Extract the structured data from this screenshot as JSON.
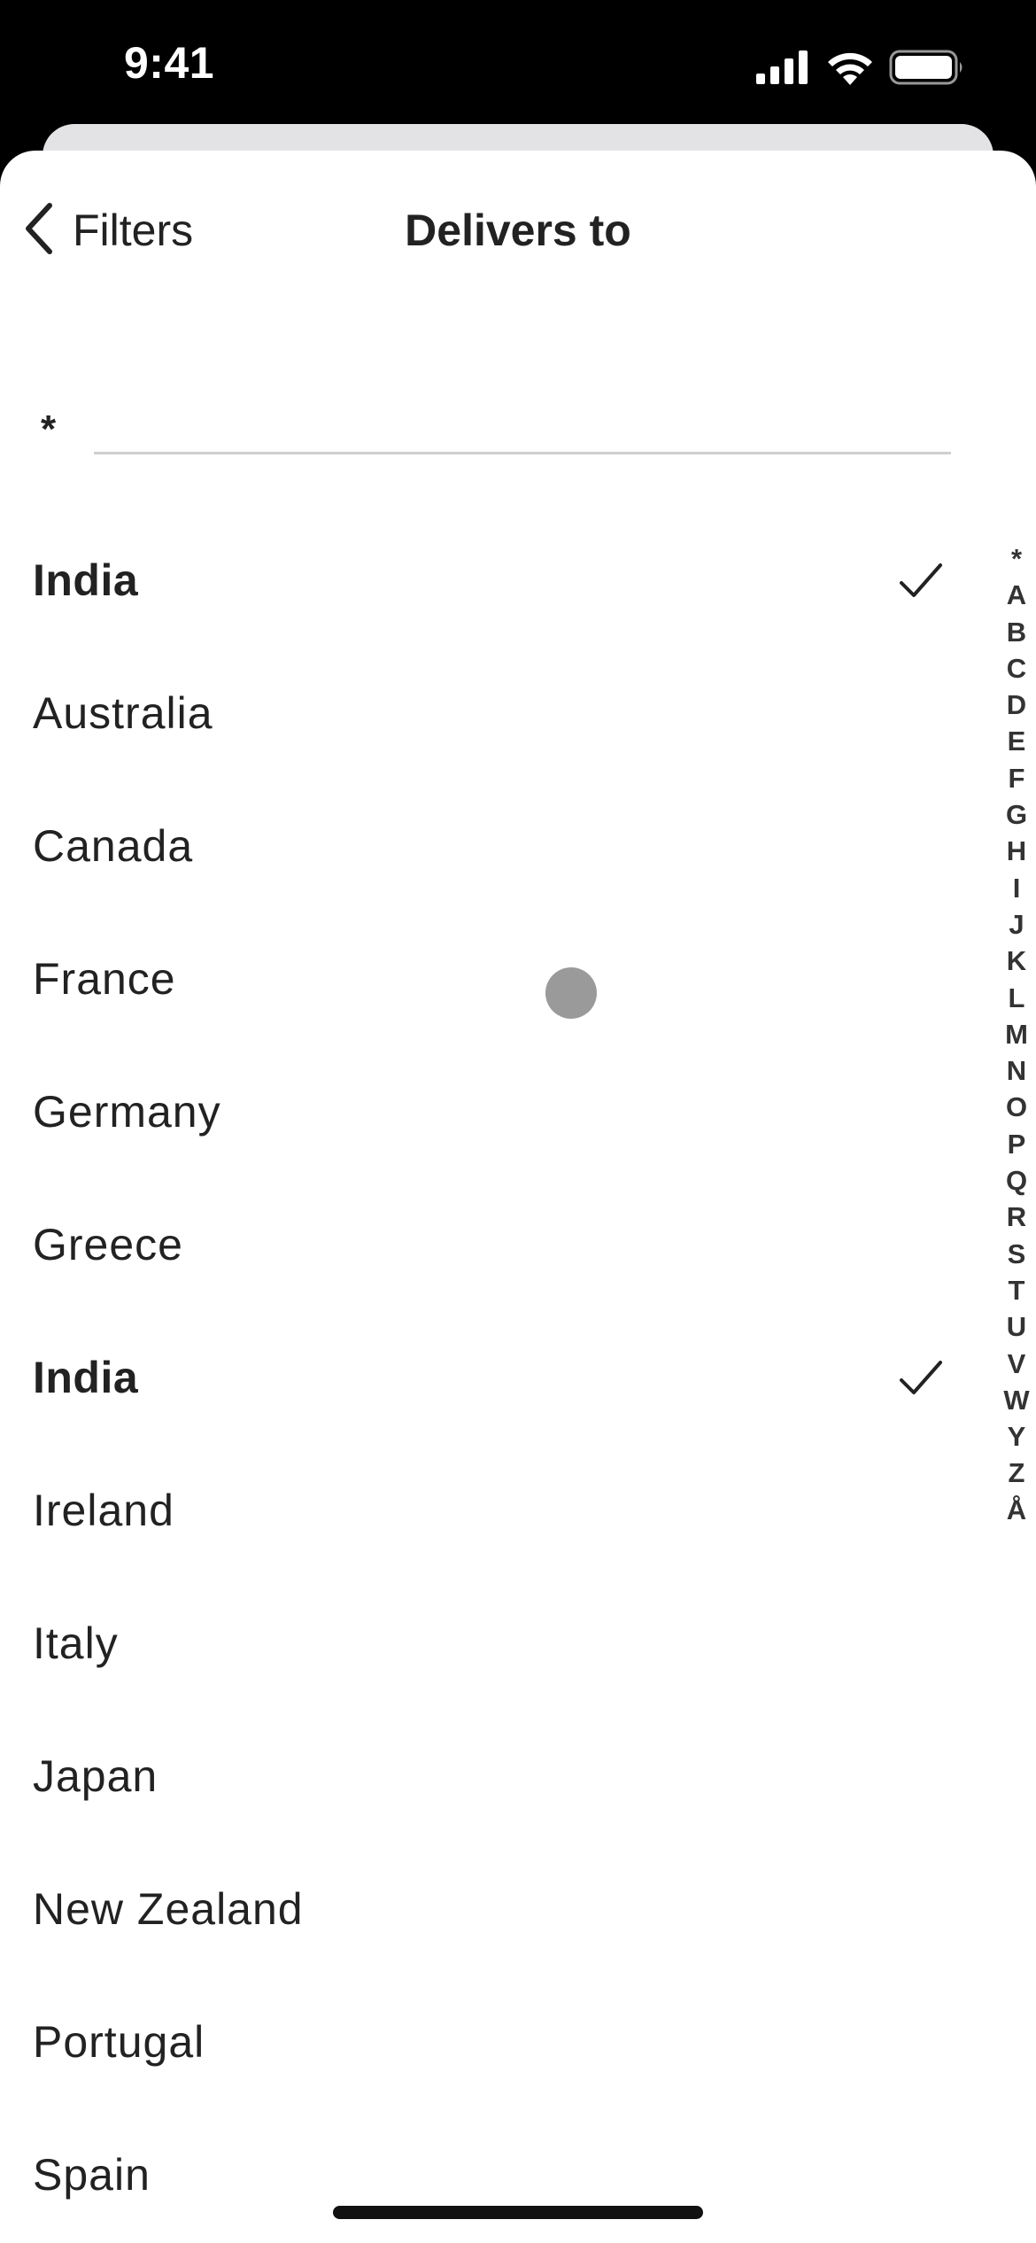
{
  "status_bar": {
    "time": "9:41",
    "icons": [
      "cellular-signal-icon",
      "wifi-icon",
      "battery-icon"
    ]
  },
  "header": {
    "back_label": "Filters",
    "title": "Delivers to"
  },
  "search": {
    "prefix": "*",
    "value": "",
    "placeholder": ""
  },
  "countries": [
    {
      "name": "India",
      "selected": true
    },
    {
      "name": "Australia",
      "selected": false
    },
    {
      "name": "Canada",
      "selected": false
    },
    {
      "name": "France",
      "selected": false
    },
    {
      "name": "Germany",
      "selected": false
    },
    {
      "name": "Greece",
      "selected": false
    },
    {
      "name": "India",
      "selected": true
    },
    {
      "name": "Ireland",
      "selected": false
    },
    {
      "name": "Italy",
      "selected": false
    },
    {
      "name": "Japan",
      "selected": false
    },
    {
      "name": "New Zealand",
      "selected": false
    },
    {
      "name": "Portugal",
      "selected": false
    },
    {
      "name": "Spain",
      "selected": false
    }
  ],
  "index_letters": [
    "*",
    "A",
    "B",
    "C",
    "D",
    "E",
    "F",
    "G",
    "H",
    "I",
    "J",
    "K",
    "L",
    "M",
    "N",
    "O",
    "P",
    "Q",
    "R",
    "S",
    "T",
    "U",
    "V",
    "W",
    "Y",
    "Z",
    "Å"
  ],
  "colors": {
    "text": "#222222",
    "divider": "#cfcfcf",
    "background": "#ffffff",
    "status_bar": "#000000",
    "touch_indicator": "#9a9a9a"
  }
}
